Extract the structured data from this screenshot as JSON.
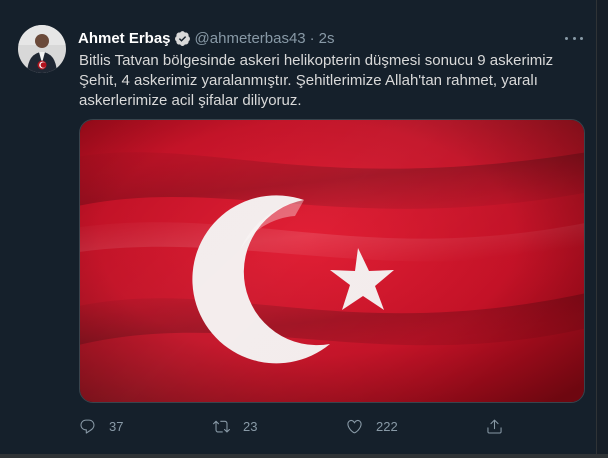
{
  "tweet": {
    "display_name": "Ahmet Erbaş",
    "handle": "@ahmeterbas43",
    "separator": "·",
    "time": "2s",
    "text_lines": [
      "Bitlis Tatvan bölgesinde askeri helikopterin düşmesi sonucu 9 askerimiz",
      "Şehit, 4 askerimiz yaralanmıştır. Şehitlerimize Allah'tan rahmet, yaralı",
      "askerlerimize acil şifalar diliyoruz."
    ],
    "media_alt": "Turkish flag",
    "counts": {
      "replies": "37",
      "retweets": "23",
      "likes": "222"
    }
  },
  "icons": {
    "verified": "verified-badge-icon",
    "more": "more-icon",
    "reply": "reply-icon",
    "retweet": "retweet-icon",
    "like": "like-icon",
    "share": "share-icon"
  },
  "colors": {
    "background": "#15202b",
    "text_primary": "#ffffff",
    "text_body": "#d9d9d9",
    "text_secondary": "#8899a6",
    "verified": "#d9d9d9",
    "flag_red": "#c8102e"
  }
}
